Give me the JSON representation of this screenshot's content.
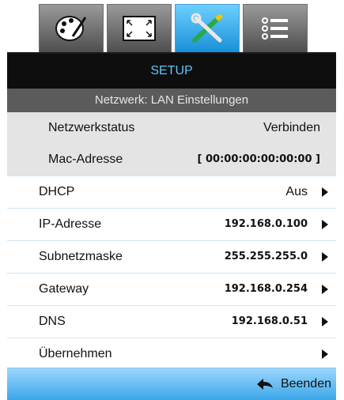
{
  "tabs": [
    {
      "icon": "palette-icon"
    },
    {
      "icon": "display-icon"
    },
    {
      "icon": "setup-tools-icon",
      "active": true
    },
    {
      "icon": "options-list-icon"
    }
  ],
  "menu": {
    "title": "SETUP",
    "subtitle": "Netzwerk: LAN Einstellungen",
    "info": [
      {
        "label": "Netzwerkstatus",
        "value": "Verbinden"
      },
      {
        "label": "Mac-Adresse",
        "value": "[ 00:00:00:00:00:00 ]"
      }
    ],
    "items": [
      {
        "label": "DHCP",
        "value": "Aus"
      },
      {
        "label": "IP-Adresse",
        "value": "192.168.0.100"
      },
      {
        "label": "Subnetzmaske",
        "value": "255.255.255.0"
      },
      {
        "label": "Gateway",
        "value": "192.168.0.254"
      },
      {
        "label": "DNS",
        "value": "192.168.0.51"
      },
      {
        "label": "Übernehmen",
        "value": ""
      }
    ]
  },
  "footer": {
    "exit_label": "Beenden",
    "icon": "back-arrow-icon"
  },
  "colors": {
    "accent": "#5fc6ff",
    "active_tab": "#1a8fd8"
  }
}
